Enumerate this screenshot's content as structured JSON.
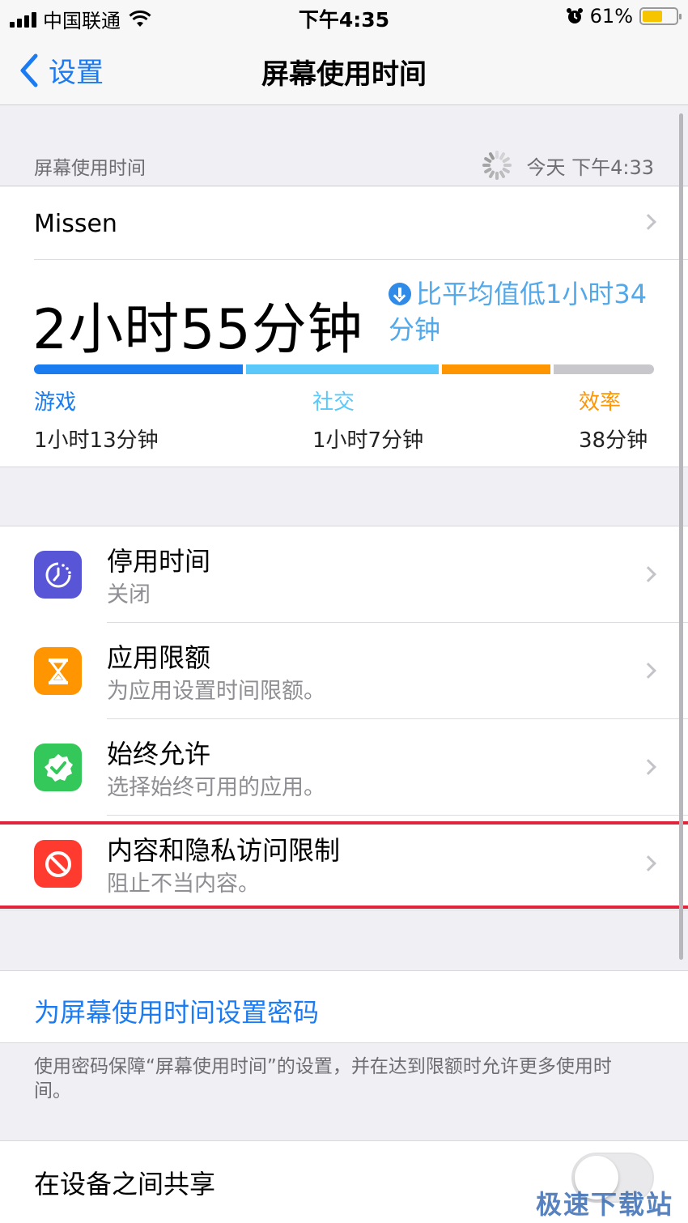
{
  "status_bar": {
    "carrier": "中国联通",
    "time": "下午4:35",
    "battery_percent": "61%",
    "battery_level": 0.61
  },
  "nav": {
    "back_label": "设置",
    "title": "屏幕使用时间"
  },
  "summary_header": {
    "label": "屏幕使用时间",
    "updated": "今天 下午4:33"
  },
  "user": {
    "name": "Missen",
    "total_time": "2小时55分钟",
    "comparison": "比平均值低1小时34分钟",
    "usage_segments": [
      {
        "name": "游戏",
        "value": "1小时13分钟",
        "minutes": 73,
        "color": "#1b7cf0"
      },
      {
        "name": "社交",
        "value": "1小时7分钟",
        "minutes": 67,
        "color": "#5ac8fa"
      },
      {
        "name": "效率",
        "value": "38分钟",
        "minutes": 38,
        "color": "#ff9500"
      },
      {
        "name": "",
        "value": "",
        "minutes": 35,
        "color": "#c7c7cc"
      }
    ]
  },
  "settings": [
    {
      "title": "停用时间",
      "subtitle": "关闭",
      "icon": "downtime-icon",
      "icon_color": "#5856d6"
    },
    {
      "title": "应用限额",
      "subtitle": "为应用设置时间限额。",
      "icon": "hourglass-icon",
      "icon_color": "#ff9500"
    },
    {
      "title": "始终允许",
      "subtitle": "选择始终可用的应用。",
      "icon": "checkmark-badge-icon",
      "icon_color": "#34c759"
    },
    {
      "title": "内容和隐私访问限制",
      "subtitle": "阻止不当内容。",
      "icon": "restriction-icon",
      "icon_color": "#ff3b30"
    }
  ],
  "passcode": {
    "link": "为屏幕使用时间设置密码",
    "note": "使用密码保障“屏幕使用时间”的设置，并在达到限额时允许更多使用时间。"
  },
  "share": {
    "label": "在设备之间共享",
    "enabled": false
  },
  "watermark": "极速下载站",
  "colors": {
    "accent": "#1a7bf2",
    "highlight": "#e0243c"
  }
}
